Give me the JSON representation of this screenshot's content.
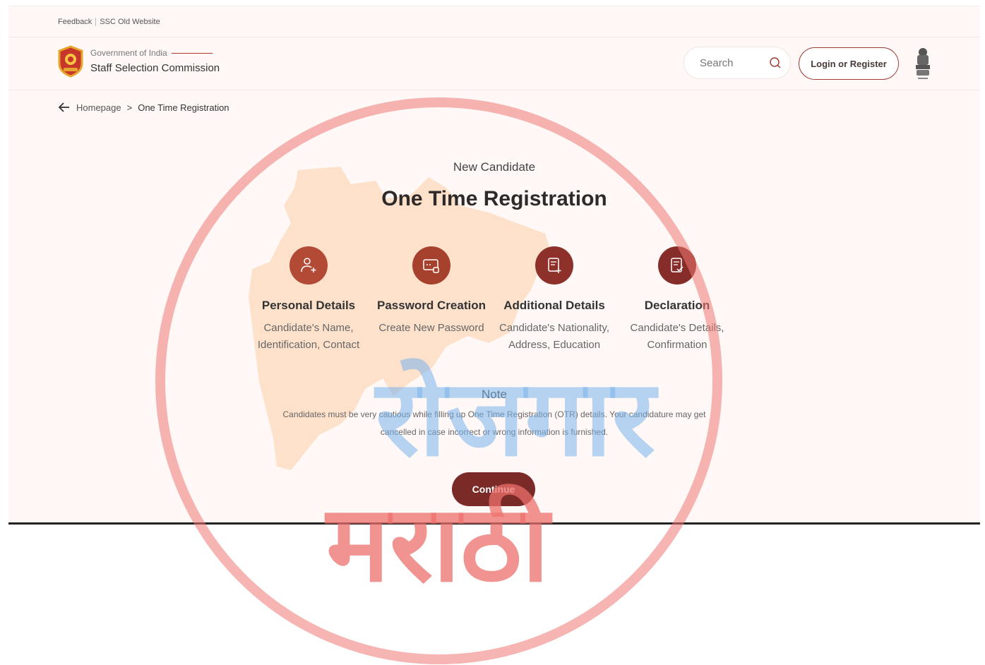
{
  "utility_bar": {
    "feedback": "Feedback",
    "old_website": "SSC Old Website"
  },
  "header": {
    "gov_label": "Government of India",
    "org_name": "Staff Selection Commission",
    "search_placeholder": "Search",
    "login_button": "Login or Register",
    "logo_icon": "ssc-logo-icon",
    "emblem_icon": "national-emblem-icon"
  },
  "breadcrumb": {
    "home": "Homepage",
    "separator": ">",
    "current": "One Time Registration"
  },
  "main": {
    "subtitle": "New Candidate",
    "title": "One Time Registration"
  },
  "steps": [
    {
      "icon": "add-user-icon",
      "color": "#b24a35",
      "title": "Personal Details",
      "desc": "Candidate's Name,\nIdentification, Contact"
    },
    {
      "icon": "password-card-icon",
      "color": "#a6412d",
      "title": "Password Creation",
      "desc": "Create New Password"
    },
    {
      "icon": "document-add-icon",
      "color": "#8e312b",
      "title": "Additional Details",
      "desc": "Candidate's Nationality,\nAddress, Education"
    },
    {
      "icon": "document-check-icon",
      "color": "#862d2a",
      "title": "Declaration",
      "desc": "Candidate's Details,\nConfirmation"
    }
  ],
  "note": {
    "label": "Note",
    "text": "Candidates must be very cautious while filling up One Time Registration (OTR) details. Your candidature may get cancelled in case incorrect or wrong information is furnished."
  },
  "continue_button": "Continue",
  "watermark": {
    "line1": "रोजगार",
    "line2": "मराठी"
  },
  "colors": {
    "accent": "#7a2a27",
    "background": "#fff8f6",
    "map": "#fde3cf"
  }
}
